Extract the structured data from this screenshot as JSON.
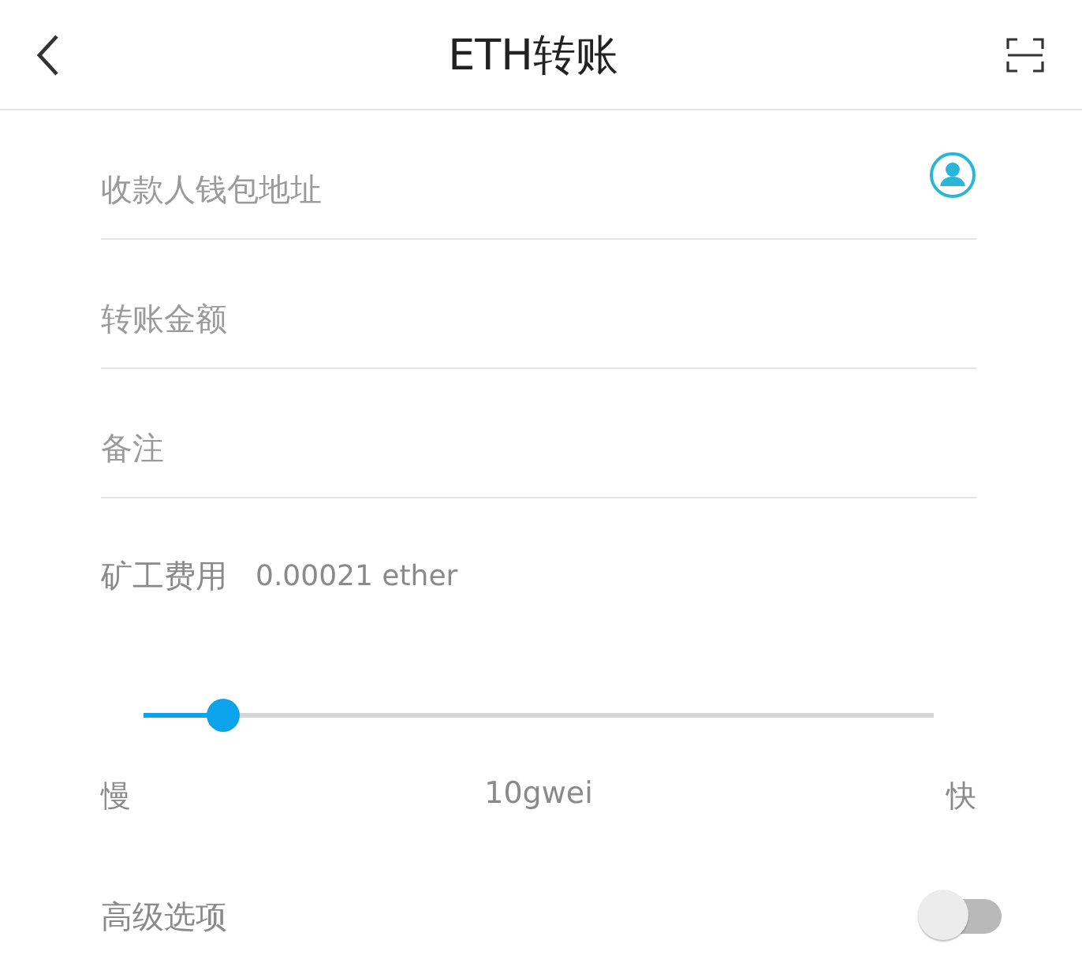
{
  "header": {
    "title": "ETH转账"
  },
  "fields": [
    {
      "placeholder": "收款人钱包地址",
      "contact_icon": true
    },
    {
      "placeholder": "转账金额",
      "contact_icon": false
    },
    {
      "placeholder": "备注",
      "contact_icon": false
    }
  ],
  "fee": {
    "label": "矿工费用",
    "value": "0.00021 ether"
  },
  "gas_slider": {
    "level": 0.1,
    "min_label": "慢",
    "value_label": "10gwei",
    "max_label": "快"
  },
  "advanced": {
    "label": "高级选项",
    "on": false
  }
}
